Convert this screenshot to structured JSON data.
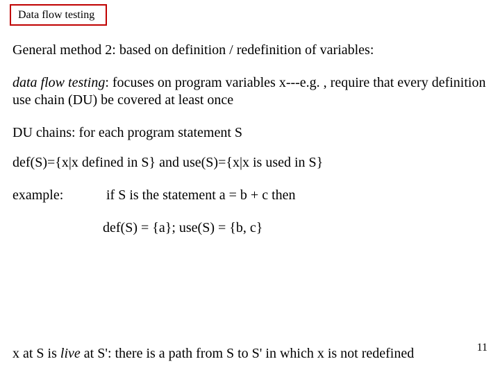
{
  "title": "Data flow testing",
  "heading": "General method 2:  based on definition / redefinition of variables:",
  "dft_label": "data flow testing",
  "dft_rest": ":  focuses on program variables x---e.g. , require that every definition use chain (DU) be covered at least once",
  "du_chains": "DU chains: for each program statement S",
  "defs": "def(S)={x|x defined in S}  and  use(S)={x|x is used in S}",
  "example_label": "example:",
  "example_text": "if S is the statement    a = b + c   then",
  "defuse": "def(S) = {a}; use(S) = {b, c}",
  "live_pre": "x at S is ",
  "live_word": "live",
  "live_post": " at S': there is a path from S to S' in which x is not redefined",
  "page_number": "11"
}
